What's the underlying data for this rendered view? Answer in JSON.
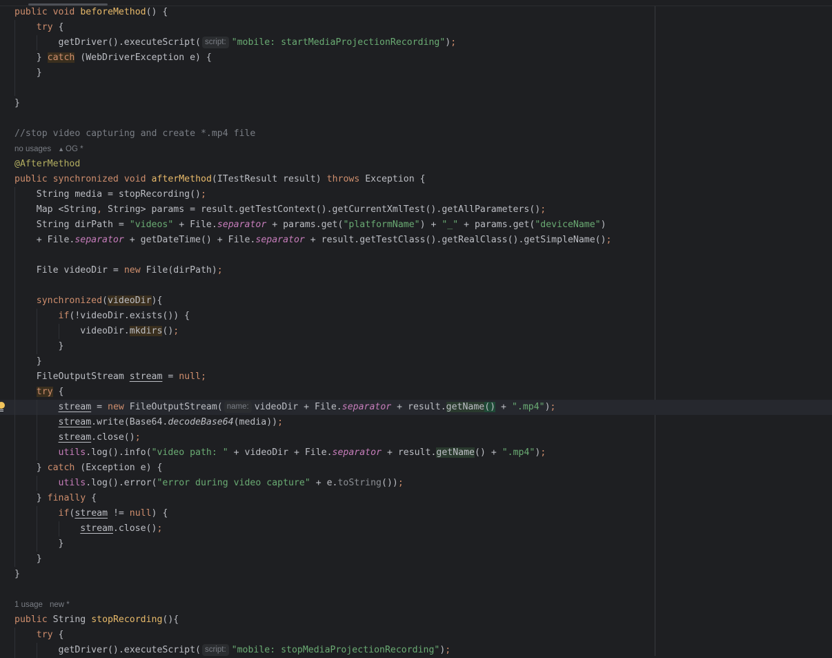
{
  "editor": {
    "language": "java",
    "colors": {
      "background": "#1e1f22",
      "keyword": "#cf8e6d",
      "method_declaration": "#e8ba6a",
      "string": "#6aab73",
      "comment": "#7a7e85",
      "annotation": "#b3ae60",
      "static_field": "#c77dbb",
      "text": "#bcbec4"
    },
    "hints": {
      "script": "script:",
      "name": "name:"
    },
    "meta": {
      "after_method_usages": "no usages",
      "after_method_author": "OG *",
      "stop_recording_usages": "1 usage",
      "stop_recording_author": "new *"
    },
    "tokens": {
      "public": "public",
      "void": "void",
      "beforeMethod": "beforeMethod",
      "try": "try",
      "catch": "catch",
      "finally": "finally",
      "getDriverExec": "getDriver().executeScript(",
      "startRec": "\"mobile: startMediaProjectionRecording\"",
      "stopRec": "\"mobile: stopMediaProjectionRecording\"",
      "webDriverEx": " (WebDriverException e) {",
      "comment": "//stop video capturing and create *.mp4 file",
      "annotation": "@AfterMethod",
      "synchronized": "synchronized",
      "afterMethod": "afterMethod",
      "afterParams": "(ITestResult result) ",
      "throws": "throws",
      "exception": " Exception {",
      "mediaLine": "String media = stopRecording()",
      "mapLine": "Map <String",
      "mapLine2": " String> params = result.getTestContext().getCurrentXmlTest().getAllParameters()",
      "dirPath1": "String dirPath = ",
      "videos": "\"videos\"",
      "plusFile": " + File.",
      "separator": "separator",
      "paramsGet": " + params.get(",
      "platformName": "\"platformName\"",
      "closeParenPlus": ") + ",
      "underscore": "\"_\"",
      "plusParamsGet": " + params.get(",
      "deviceName": "\"deviceName\"",
      "closeParen": ")",
      "plusFileStart": "+ File.",
      "getDateTime": " + getDateTime() + File.",
      "simpleName": " + result.getTestClass().getRealClass().getSimpleName()",
      "fileVideoDir": "File videoDir = ",
      "new": "new",
      "fileDirPath": " File(dirPath)",
      "videoDir": "videoDir",
      "syncClose": "){",
      "if": "if",
      "notExists": "(!videoDir.exists()) {",
      "videoDirDot": "videoDir.",
      "mkdirs": "mkdirs",
      "parens": "()",
      "fosDecl": "FileOutputStream ",
      "stream": "stream",
      "eqSp": " = ",
      "null": "null",
      "fosNew": " FileOutputStream(",
      "videoDirPlus": "videoDir + File.",
      "resultGetName": " + result.",
      "getName": "getName",
      "plusMp4": " + ",
      "mp4": "\".mp4\"",
      "write": ".write(Base64.",
      "decodeBase64": "decodeBase64",
      "mediaClose": "(media))",
      "close": ".close()",
      "utils": "utils",
      "logInfo": ".log().info(",
      "videoPath": "\"video path: \"",
      "logError": ".log().error(",
      "errorMsg": "\"error during video capture\"",
      "plusE": " + e.",
      "toString": "toString",
      "toStringClose": "())",
      "exceptionE": " (Exception e) {",
      "neqNull": " != ",
      "braceOpen": " {",
      "braceClose": "}",
      "closeBraceSp": "} ",
      "string": "String",
      "stopRecording": "stopRecording",
      "stopRecOpen": "(){",
      "openParen": "(",
      "semi": ";",
      "comma": ","
    }
  }
}
